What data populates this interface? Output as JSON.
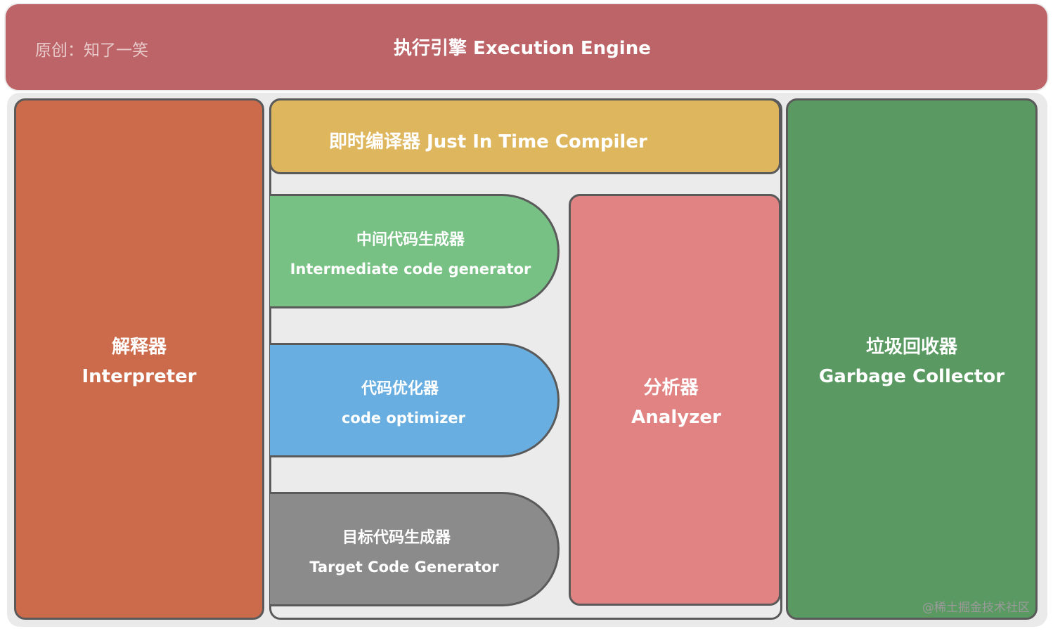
{
  "header": {
    "credit": "原创：知了一笑",
    "title": "执行引擎 Execution Engine"
  },
  "interpreter": {
    "cn": "解释器",
    "en": "Interpreter"
  },
  "jit": {
    "title": "即时编译器 Just In Time Compiler"
  },
  "intermediate_code_generator": {
    "cn": "中间代码生成器",
    "en": "Intermediate code generator"
  },
  "code_optimizer": {
    "cn": "代码优化器",
    "en": "code optimizer"
  },
  "target_code_generator": {
    "cn": "目标代码生成器",
    "en": "Target Code Generator"
  },
  "analyzer": {
    "cn": "分析器",
    "en": "Analyzer"
  },
  "garbage_collector": {
    "cn": "垃圾回收器",
    "en": "Garbage Collector"
  },
  "watermark": "@稀土掘金技术社区",
  "colors": {
    "header": "#bd6468",
    "interpreter": "#cc6b4b",
    "jit": "#deb65e",
    "intermediate_code_generator": "#77c184",
    "code_optimizer": "#68aee0",
    "target_code_generator": "#8b8b8b",
    "analyzer": "#e28383",
    "garbage_collector": "#5a9a62"
  }
}
